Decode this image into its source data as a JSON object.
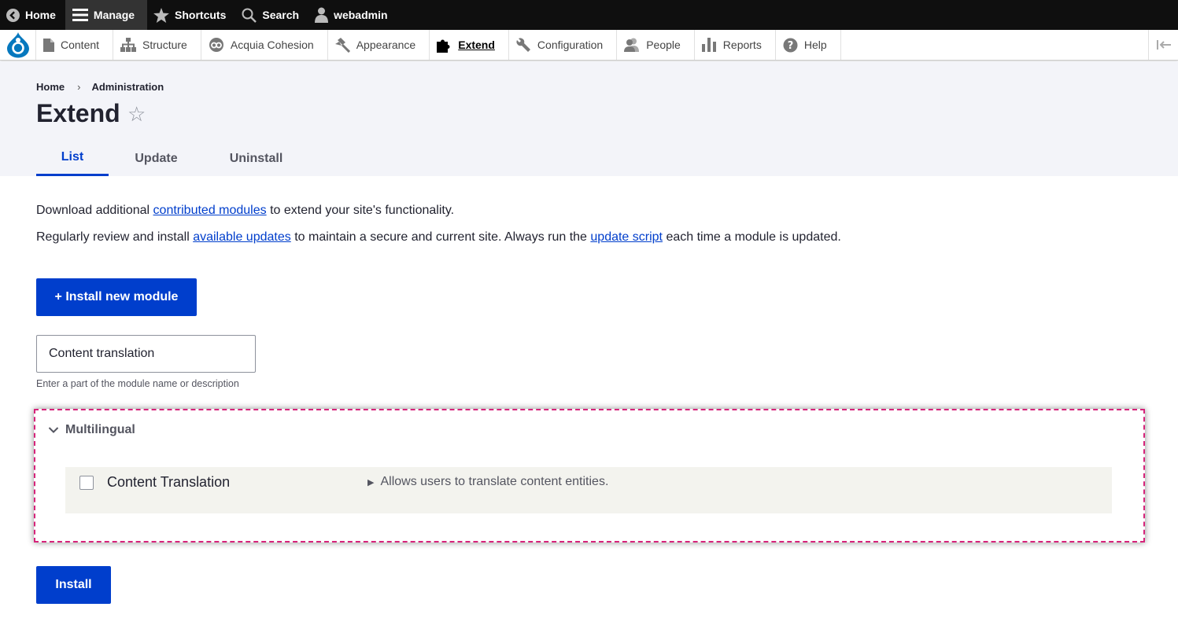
{
  "toolbar": {
    "items": [
      {
        "label": "Home",
        "icon": "back-circle-icon"
      },
      {
        "label": "Manage",
        "icon": "hamburger-icon"
      },
      {
        "label": "Shortcuts",
        "icon": "star-icon"
      },
      {
        "label": "Search",
        "icon": "search-icon"
      },
      {
        "label": "webadmin",
        "icon": "user-icon"
      }
    ]
  },
  "tray": {
    "items": [
      {
        "label": "Content",
        "icon": "document-icon"
      },
      {
        "label": "Structure",
        "icon": "sitemap-icon"
      },
      {
        "label": "Acquia Cohesion",
        "icon": "cohesion-icon"
      },
      {
        "label": "Appearance",
        "icon": "paintbrush-icon"
      },
      {
        "label": "Extend",
        "icon": "puzzle-icon"
      },
      {
        "label": "Configuration",
        "icon": "wrench-icon"
      },
      {
        "label": "People",
        "icon": "people-icon"
      },
      {
        "label": "Reports",
        "icon": "bar-chart-icon"
      },
      {
        "label": "Help",
        "icon": "help-icon"
      }
    ]
  },
  "breadcrumb": {
    "items": [
      "Home",
      "Administration"
    ],
    "separator": "›"
  },
  "page": {
    "title": "Extend",
    "favorite_glyph": "☆"
  },
  "tabs": [
    {
      "label": "List"
    },
    {
      "label": "Update"
    },
    {
      "label": "Uninstall"
    }
  ],
  "intro": {
    "p1": {
      "before": "Download additional ",
      "link": "contributed modules",
      "after": " to extend your site's functionality."
    },
    "p2": {
      "before": "Regularly review and install ",
      "link1": "available updates",
      "middle": " to maintain a secure and current site. Always run the ",
      "link2": "update script",
      "after": " each time a module is updated."
    }
  },
  "install_new_button": "+ Install new module",
  "filter": {
    "value": "Content translation",
    "description": "Enter a part of the module name or description"
  },
  "group": {
    "title": "Multilingual",
    "modules": [
      {
        "name": "Content Translation",
        "description": "Allows users to translate content entities.",
        "checked": false
      }
    ]
  },
  "install_button": "Install",
  "colors": {
    "accent": "#003ecc",
    "toolbar_bg": "#0f0f0f",
    "header_bg": "#f3f4f9",
    "highlight_border": "#d6237a"
  }
}
